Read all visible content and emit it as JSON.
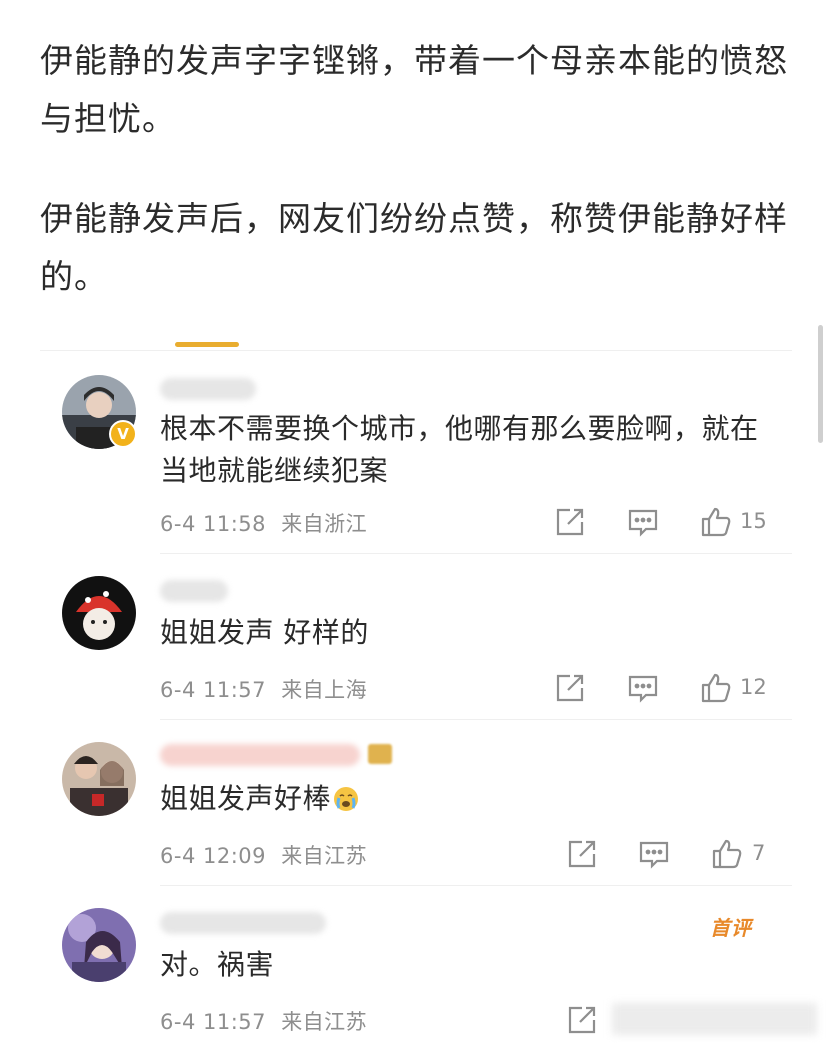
{
  "article": {
    "paragraph1": "伊能静的发声字字铿锵，带着一个母亲本能的愤怒与担忧。",
    "paragraph2": "伊能静发声后，网友们纷纷点赞，称赞伊能静好样的。"
  },
  "comments": [
    {
      "text": "根本不需要换个城市，他哪有那么要脸啊，就在当地就能继续犯案",
      "date": "6-4 11:58",
      "location": "来自浙江",
      "likes": "15",
      "verified": true
    },
    {
      "text": "姐姐发声 好样的",
      "date": "6-4 11:57",
      "location": "来自上海",
      "likes": "12"
    },
    {
      "text": "姐姐发声好棒",
      "emoji": "crying-face",
      "date": "6-4 12:09",
      "location": "来自江苏",
      "likes": "7"
    },
    {
      "text": "对。祸害",
      "badge": "首评",
      "date": "6-4 11:57",
      "location": "来自江苏"
    }
  ],
  "colors": {
    "accent": "#e9ad2f",
    "meta_text": "#8e8e8e",
    "first_badge": "#e8892a"
  }
}
